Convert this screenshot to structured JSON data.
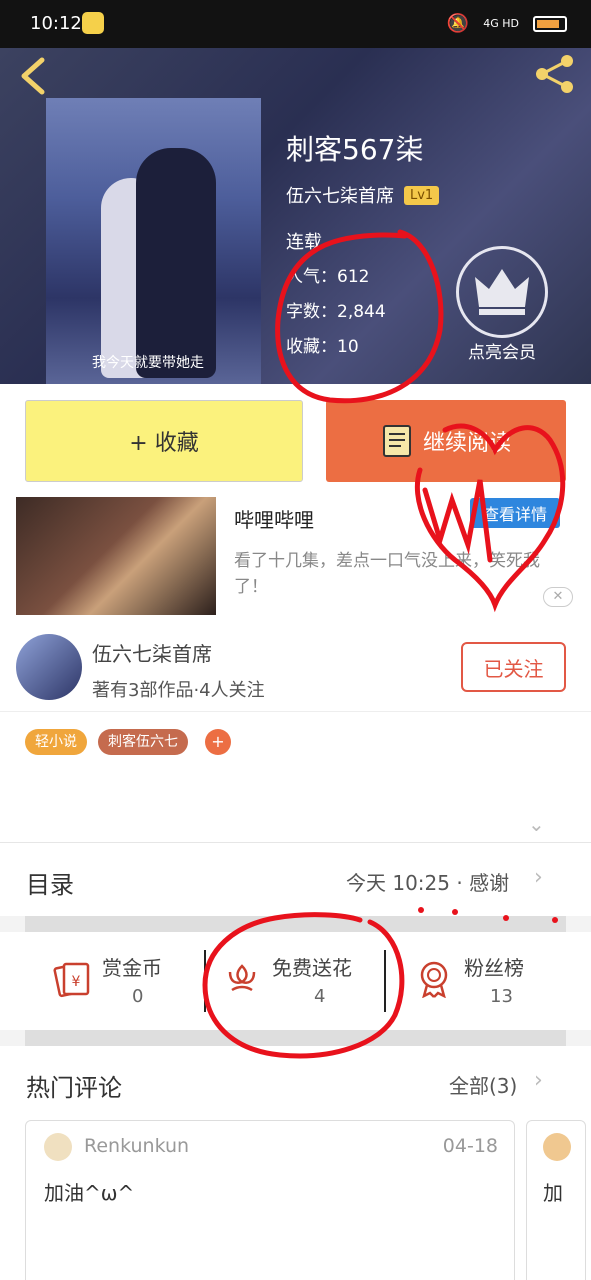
{
  "status_bar": {
    "time": "10:12",
    "network": "4G HD"
  },
  "book": {
    "title": "刺客567柒",
    "author": "伍六七柒首席",
    "level": "Lv1",
    "status": "连载",
    "popularity": "人气：612",
    "word_count": "字数：2,844",
    "favorites": "收藏：10",
    "cover_caption": "我今天就要带她走"
  },
  "vip": {
    "label": "点亮会员"
  },
  "actions": {
    "favorite": "+ 收藏",
    "continue_reading": "继续阅读"
  },
  "ad": {
    "title": "哔哩哔哩",
    "button": "查看详情",
    "description": "看了十几集，差点一口气没上来，笑死我了！",
    "close": "✕"
  },
  "author_card": {
    "name": "伍六七柒首席",
    "meta": "著有3部作品·4人关注",
    "follow_status": "已关注"
  },
  "tags": [
    {
      "label": "轻小说",
      "color": "#f0a63c"
    },
    {
      "label": "刺客伍六七",
      "color": "#c56b4e"
    }
  ],
  "tag_add": "+",
  "catalog": {
    "title": "目录",
    "meta": "今天 10:25 · 感谢"
  },
  "rewards": [
    {
      "label": "赏金币",
      "count": "0",
      "icon": "red-envelope-icon"
    },
    {
      "label": "免费送花",
      "count": "4",
      "icon": "flower-icon"
    },
    {
      "label": "粉丝榜",
      "count": "13",
      "icon": "medal-icon"
    }
  ],
  "comments": {
    "title": "热门评论",
    "all": "全部(3)",
    "items": [
      {
        "user": "Renkunkun",
        "date": "04-18",
        "text": "加油^ω^"
      },
      {
        "user": "",
        "date": "",
        "text": "加"
      }
    ]
  },
  "colors": {
    "accent": "#ec6e43",
    "favorite_bg": "#fbf27d",
    "follow": "#e25845",
    "ad_button": "#2e86de",
    "scribble": "#e8121c"
  }
}
